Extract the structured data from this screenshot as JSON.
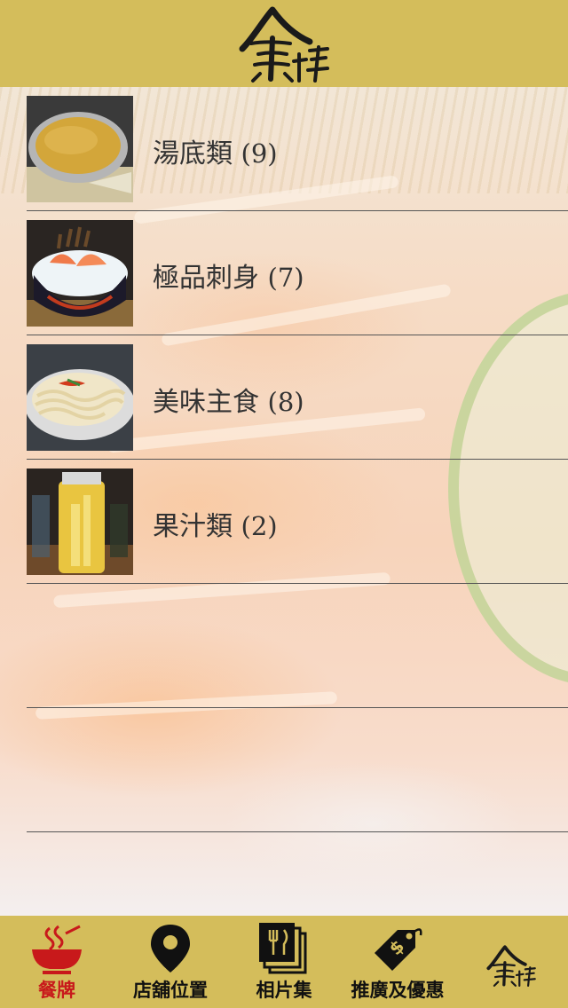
{
  "header": {
    "logo": "金撈"
  },
  "categories": [
    {
      "name": "湯底類",
      "count": "(9)",
      "thumb_icon": "soup-pot-photo"
    },
    {
      "name": "極品刺身",
      "count": "(7)",
      "thumb_icon": "sashimi-bowl-photo"
    },
    {
      "name": "美味主食",
      "count": "(8)",
      "thumb_icon": "noodles-plate-photo"
    },
    {
      "name": "果汁類",
      "count": "(2)",
      "thumb_icon": "juice-jar-photo"
    }
  ],
  "tabbar": {
    "items": [
      {
        "label": "餐牌",
        "icon": "bowl-icon",
        "active": true
      },
      {
        "label": "店舖位置",
        "icon": "map-pin-icon",
        "active": false
      },
      {
        "label": "相片集",
        "icon": "photo-album-icon",
        "active": false
      },
      {
        "label": "推廣及優惠",
        "icon": "price-tag-icon",
        "active": false
      }
    ],
    "logo": "金撈"
  },
  "colors": {
    "bar": "#d4bd5b",
    "active_tab": "#c8191b",
    "divider": "#555555"
  }
}
